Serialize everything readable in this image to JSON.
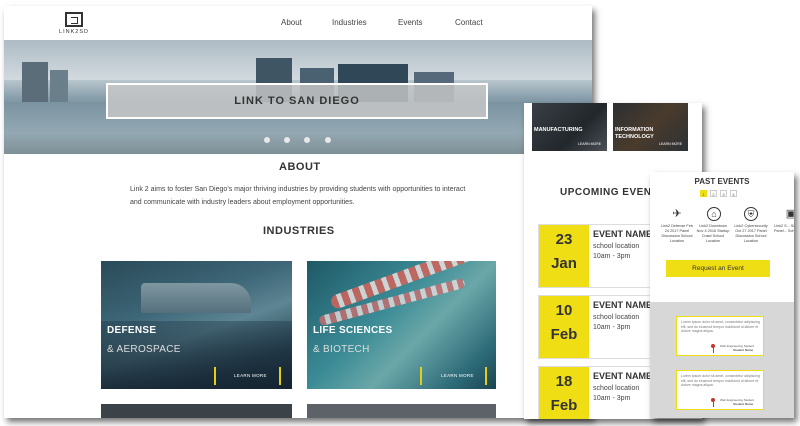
{
  "main": {
    "logo_text": "LINK2SD",
    "nav": [
      "About",
      "Industries",
      "Events",
      "Contact"
    ],
    "hero_title": "LINK TO SAN DIEGO",
    "carousel_slides": 4,
    "about_title": "ABOUT",
    "about_text": "Link 2 aims to foster San Diego’s major thriving industries by providing students with opportunities to interact and communicate with industry leaders about employment opportunities.",
    "industries_title": "INDUSTRIES",
    "cards": [
      {
        "title": "DEFENSE",
        "sub": "& AEROSPACE",
        "learn": "LEARN MORE"
      },
      {
        "title": "LIFE SCIENCES",
        "sub": "& BIOTECH",
        "learn": "LEARN MORE"
      }
    ]
  },
  "middle": {
    "tiles": [
      {
        "label": "MANUFACTURING",
        "learn": "LEARN MORE"
      },
      {
        "label": "INFORMATION\nTECHNOLOGY",
        "learn": "LEARN MORE"
      }
    ],
    "upcoming_title": "UPCOMING EVENTS",
    "events": [
      {
        "day": "23",
        "month": "Jan",
        "name": "EVENT NAME",
        "location": "school location",
        "time": "10am - 3pm"
      },
      {
        "day": "10",
        "month": "Feb",
        "name": "EVENT NAME",
        "location": "school location",
        "time": "10am - 3pm"
      },
      {
        "day": "18",
        "month": "Feb",
        "name": "EVENT NAME",
        "location": "school location",
        "time": "10am - 3pm"
      }
    ]
  },
  "right": {
    "past_title": "PAST EVENTS",
    "pages": [
      "1",
      "2",
      "3",
      "4"
    ],
    "past_events": [
      {
        "icon": "plane-icon",
        "glyph": "✈",
        "text": "Link2 Defense Feb 24 2017 Panel Discussion School Location"
      },
      {
        "icon": "building-icon",
        "glyph": "⌂",
        "text": "Link2 Downtown Nov 4 2016 Startup Crawl School Location"
      },
      {
        "icon": "shield-icon",
        "glyph": "⛨",
        "text": "Link2 Cybersecurity Oct 27 2017 Panel Discussion School Location"
      },
      {
        "icon": "calendar-icon",
        "glyph": "▣",
        "text": "Link2 S... Se... Panel... Schoo..."
      }
    ],
    "request_button": "Request an Event",
    "testimonials": [
      {
        "text": "Lorem ipsum dolor sit amet, consectetur adipiscing elit, sed do eiusmod tempor incididunt ut labore et dolore magna aliqua.",
        "role": "Web Engineering Student",
        "name": "Student Name"
      },
      {
        "text": "Lorem ipsum dolor sit amet, consectetur adipiscing elit, sed do eiusmod tempor incididunt ut labore et dolore magna aliqua.",
        "role": "Web Engineering Student",
        "name": "Student Name"
      }
    ]
  },
  "colors": {
    "accent": "#f0de14",
    "text": "#333333"
  }
}
